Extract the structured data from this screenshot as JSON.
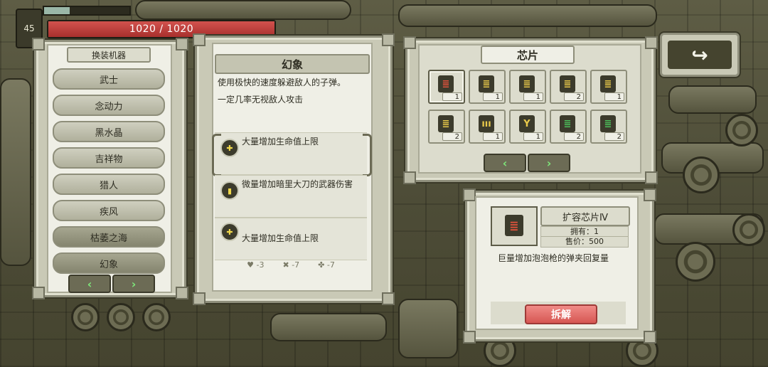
{
  "hud": {
    "level": "45",
    "hp_text": "1020 / 1020",
    "hp_fraction": 1.0,
    "xp_fraction": 0.3
  },
  "left_panel": {
    "title": "换装机器",
    "items": [
      {
        "label": "武士",
        "active": false
      },
      {
        "label": "念动力",
        "active": false
      },
      {
        "label": "黑水晶",
        "active": false
      },
      {
        "label": "吉祥物",
        "active": false
      },
      {
        "label": "猎人",
        "active": false
      },
      {
        "label": "疾风",
        "active": false
      },
      {
        "label": "枯萎之海",
        "active": true
      },
      {
        "label": "幻象",
        "active": true
      }
    ],
    "prev_icon": "chevron-left-icon",
    "next_icon": "chevron-right-icon"
  },
  "middle_panel": {
    "title": "幻象",
    "description_1": "使用极快的速度躲避敌人的子弹。",
    "description_2": "一定几率无视敌人攻击",
    "perks": [
      {
        "icon": "plus-chip-icon",
        "text": "大量增加生命值上限",
        "selected": true
      },
      {
        "icon": "blade-chip-icon",
        "text": "微量增加暗里大刀的武器伤害",
        "selected": false
      },
      {
        "icon": "plus-chip-icon",
        "text": "大量增加生命值上限",
        "selected": false
      }
    ],
    "stats": [
      {
        "icon": "heart-icon",
        "value": "-3"
      },
      {
        "icon": "cross-icon",
        "value": "-7"
      },
      {
        "icon": "clover-icon",
        "value": "-7"
      }
    ]
  },
  "chips_panel": {
    "title": "芯片",
    "chips": [
      {
        "icon": "red-chip-icon",
        "color": "#e2533d",
        "count": "1",
        "selected": true
      },
      {
        "icon": "yellow-chip-icon",
        "color": "#e9c94a",
        "count": "1",
        "selected": false
      },
      {
        "icon": "yellow-chip-icon",
        "color": "#e9c94a",
        "count": "1",
        "selected": false
      },
      {
        "icon": "yellow-chip-icon",
        "color": "#e9c94a",
        "count": "2",
        "selected": false
      },
      {
        "icon": "yellow-chip-icon",
        "color": "#e9c94a",
        "count": "1",
        "selected": false
      },
      {
        "icon": "yellow-chip-icon",
        "color": "#e9c94a",
        "count": "2",
        "selected": false
      },
      {
        "icon": "yellow-bars-chip-icon",
        "color": "#e9c94a",
        "count": "1",
        "selected": false
      },
      {
        "icon": "yellow-y-chip-icon",
        "color": "#e9c94a",
        "count": "1",
        "selected": false
      },
      {
        "icon": "green-chip-icon",
        "color": "#4bbf5a",
        "count": "2",
        "selected": false
      },
      {
        "icon": "green-chip-icon",
        "color": "#4bbf5a",
        "count": "2",
        "selected": false
      }
    ]
  },
  "detail_panel": {
    "name": "扩容芯片Ⅳ",
    "owned": "拥有：1",
    "price": "售价：500",
    "description": "巨量增加泡泡枪的弹夹回复量",
    "dismantle_label": "拆解",
    "icon": "red-chip-icon"
  },
  "back_button": {
    "icon": "return-arrow-icon",
    "glyph": "↪"
  }
}
